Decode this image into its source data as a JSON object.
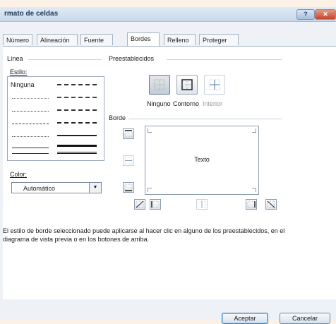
{
  "window": {
    "title": "rmato de celdas",
    "help_label": "?",
    "close_label": "✕"
  },
  "tabs": [
    {
      "label": "Número"
    },
    {
      "label": "Alineación"
    },
    {
      "label": "Fuente"
    },
    {
      "label": "Bordes"
    },
    {
      "label": "Relleno"
    },
    {
      "label": "Proteger"
    }
  ],
  "active_tab": "Bordes",
  "linea": {
    "group_label": "Línea",
    "estilo_label": "Estilo:",
    "ninguna_label": "Ninguna",
    "color_label": "Color:",
    "color_value": "Automático"
  },
  "preestablecidos": {
    "group_label": "Preestablecidos",
    "ninguno_label": "Ninguno",
    "contorno_label": "Contorno",
    "interior_label": "Interior"
  },
  "borde": {
    "group_label": "Borde",
    "preview_text": "Texto"
  },
  "description": "El estilo de borde seleccionado puede aplicarse al hacer clic en alguno de los preestablecidos, en el diagrama de vista previa o en los botones de arriba.",
  "buttons": {
    "accept_label": "Aceptar",
    "cancel_label": "Cancelar"
  }
}
